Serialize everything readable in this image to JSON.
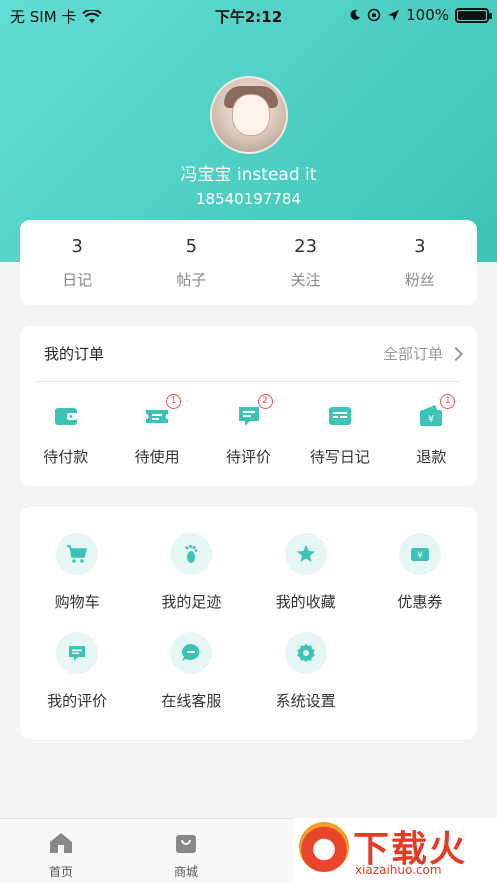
{
  "status_bar": {
    "carrier": "无 SIM 卡",
    "time": "下午2:12",
    "battery": "100%"
  },
  "profile": {
    "username": "冯宝宝 instead it",
    "phone": "18540197784"
  },
  "stats": [
    {
      "value": "3",
      "label": "日记"
    },
    {
      "value": "5",
      "label": "帖子"
    },
    {
      "value": "23",
      "label": "关注"
    },
    {
      "value": "3",
      "label": "粉丝"
    }
  ],
  "orders": {
    "title": "我的订单",
    "all_label": "全部订单",
    "items": [
      {
        "label": "待付款",
        "icon": "wallet-icon",
        "badge": ""
      },
      {
        "label": "待使用",
        "icon": "ticket-icon",
        "badge": "1"
      },
      {
        "label": "待评价",
        "icon": "comment-icon",
        "badge": "2"
      },
      {
        "label": "待写日记",
        "icon": "diary-icon",
        "badge": ""
      },
      {
        "label": "退款",
        "icon": "refund-icon",
        "badge": "1"
      }
    ]
  },
  "services": [
    {
      "label": "购物车",
      "icon": "cart-icon"
    },
    {
      "label": "我的足迹",
      "icon": "footprint-icon"
    },
    {
      "label": "我的收藏",
      "icon": "star-icon"
    },
    {
      "label": "优惠券",
      "icon": "coupon-icon"
    },
    {
      "label": "我的评价",
      "icon": "review-icon"
    },
    {
      "label": "在线客服",
      "icon": "chat-icon"
    },
    {
      "label": "系统设置",
      "icon": "gear-icon"
    }
  ],
  "tabbar": [
    {
      "label": "首页",
      "icon": "home-icon"
    },
    {
      "label": "商城",
      "icon": "bag-icon"
    }
  ],
  "watermark": {
    "title": "下载火",
    "site": "xiazaihuo.com"
  },
  "colors": {
    "accent": "#3cc3b5",
    "header_start": "#64ddd4",
    "badge": "#e45050"
  }
}
